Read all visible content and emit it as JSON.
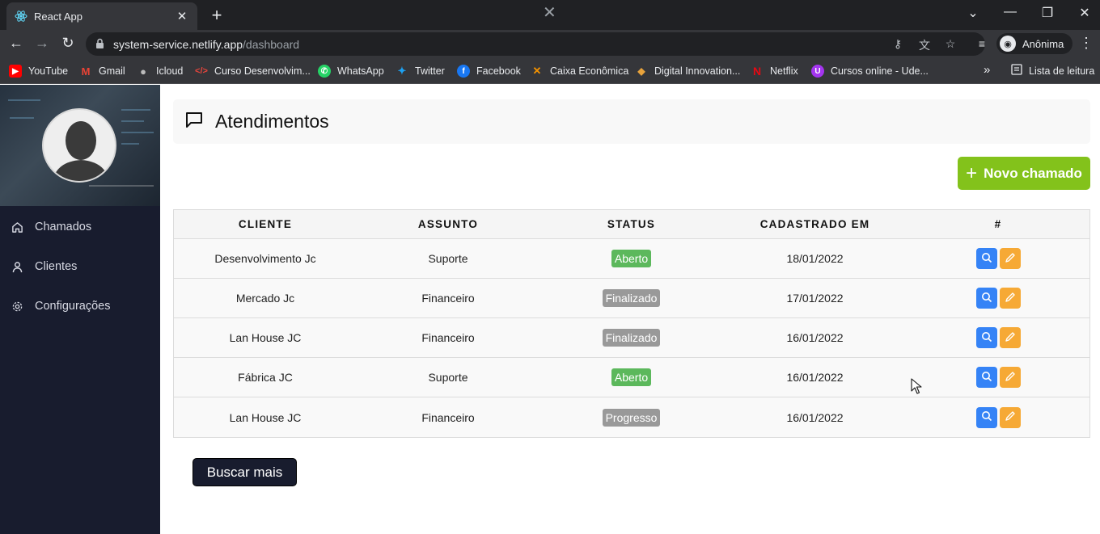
{
  "browser": {
    "tab_title": "React App",
    "url_host": "system-service.netlify.app",
    "url_path": "/dashboard",
    "profile_name": "Anônima",
    "bookmarks": [
      {
        "label": "YouTube",
        "icon": "youtube-icon",
        "color": "#ff0000"
      },
      {
        "label": "Gmail",
        "icon": "gmail-icon",
        "color": "#ea4335"
      },
      {
        "label": "Icloud",
        "icon": "apple-icon",
        "color": "#9e9e9e"
      },
      {
        "label": "Curso Desenvolvim...",
        "icon": "code-icon",
        "color": "#e8453c"
      },
      {
        "label": "WhatsApp",
        "icon": "whatsapp-icon",
        "color": "#25d366"
      },
      {
        "label": "Twitter",
        "icon": "twitter-icon",
        "color": "#1da1f2"
      },
      {
        "label": "Facebook",
        "icon": "facebook-icon",
        "color": "#1877f2"
      },
      {
        "label": "Caixa Econômica",
        "icon": "caixa-icon",
        "color": "#f39200"
      },
      {
        "label": "Digital Innovation...",
        "icon": "dio-icon",
        "color": "#e8a33c"
      },
      {
        "label": "Netflix",
        "icon": "netflix-icon",
        "color": "#e50914"
      },
      {
        "label": "Cursos online - Ude...",
        "icon": "udemy-icon",
        "color": "#a435f0"
      }
    ],
    "reading_list": "Lista de leitura"
  },
  "sidebar": {
    "items": [
      {
        "label": "Chamados",
        "icon": "home-icon"
      },
      {
        "label": "Clientes",
        "icon": "user-icon"
      },
      {
        "label": "Configurações",
        "icon": "settings-icon"
      }
    ]
  },
  "main": {
    "title": "Atendimentos",
    "new_button": "Novo chamado",
    "load_more": "Buscar mais"
  },
  "table": {
    "headers": [
      "CLIENTE",
      "ASSUNTO",
      "STATUS",
      "CADASTRADO EM",
      "#"
    ],
    "rows": [
      {
        "cliente": "Desenvolvimento Jc",
        "assunto": "Suporte",
        "status": "Aberto",
        "status_color": "#5cb85c",
        "cadastrado": "18/01/2022"
      },
      {
        "cliente": "Mercado Jc",
        "assunto": "Financeiro",
        "status": "Finalizado",
        "status_color": "#999999",
        "cadastrado": "17/01/2022"
      },
      {
        "cliente": "Lan House JC",
        "assunto": "Financeiro",
        "status": "Finalizado",
        "status_color": "#999999",
        "cadastrado": "16/01/2022"
      },
      {
        "cliente": "Fábrica JC",
        "assunto": "Suporte",
        "status": "Aberto",
        "status_color": "#5cb85c",
        "cadastrado": "16/01/2022"
      },
      {
        "cliente": "Lan House JC",
        "assunto": "Financeiro",
        "status": "Progresso",
        "status_color": "#999999",
        "cadastrado": "16/01/2022"
      }
    ]
  },
  "colors": {
    "sidebar_bg": "#181c2e",
    "accent_green": "#83c21b",
    "search_button": "#3583f6",
    "edit_button": "#f6a935"
  }
}
